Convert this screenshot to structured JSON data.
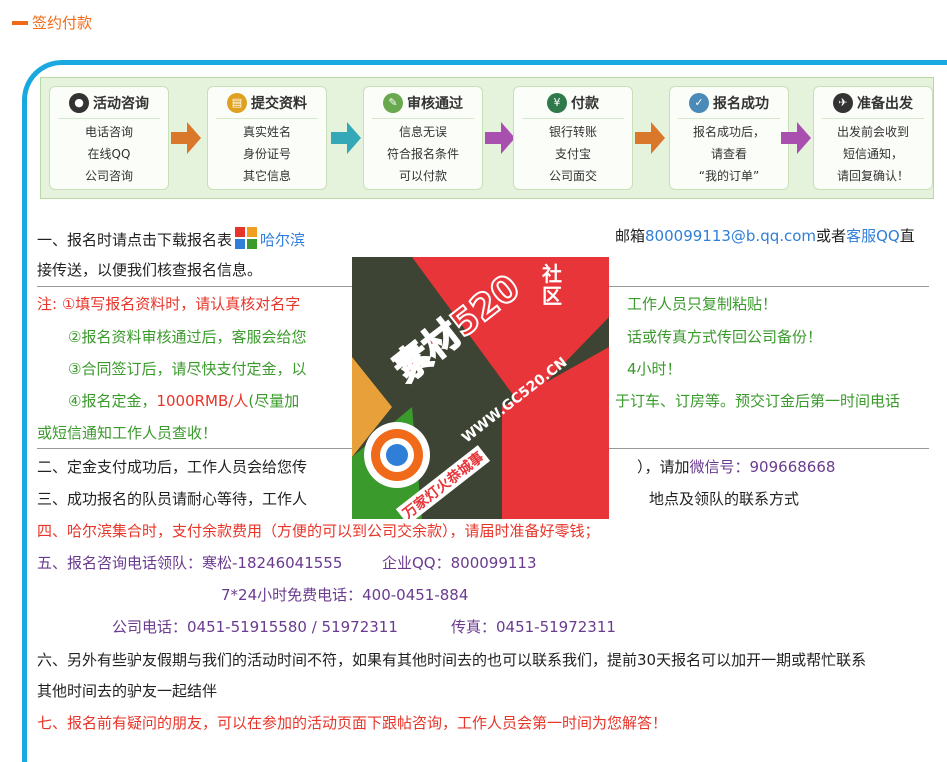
{
  "section": {
    "title": "签约付款"
  },
  "flow": {
    "steps": [
      {
        "icon": "user-icon",
        "title": "活动咨询",
        "lines": [
          "电话咨询",
          "在线QQ",
          "公司咨询"
        ]
      },
      {
        "icon": "document-icon",
        "title": "提交资料",
        "lines": [
          "真实姓名",
          "身份证号",
          "其它信息"
        ]
      },
      {
        "icon": "edit-icon",
        "title": "审核通过",
        "lines": [
          "信息无误",
          "符合报名条件",
          "可以付款"
        ]
      },
      {
        "icon": "money-icon",
        "title": "付款",
        "lines": [
          "银行转账",
          "支付宝",
          "公司面交"
        ]
      },
      {
        "icon": "check-icon",
        "title": "报名成功",
        "lines": [
          "报名成功后，",
          "请查看",
          "“我的订单”"
        ]
      },
      {
        "icon": "plane-icon",
        "title": "准备出发",
        "lines": [
          "出发前会收到",
          "短信通知，",
          "请回复确认！"
        ]
      }
    ]
  },
  "content": {
    "l1_a": "一、报名时请点击下载报名表",
    "l1_b": "哈尔滨",
    "l1_c": "邮箱",
    "l1_email": "800099113@b.qq.com",
    "l1_d": "或者",
    "l1_kf": "客服QQ",
    "l1_e": "直",
    "l2": "接传送，以便我们核查报名信息。",
    "n1_a": "注:  ①填写报名资料时，请认真核对名字",
    "n1_b": "工作人员只复制粘贴！",
    "n2_a": "②报名资料审核通过后，客服会给您",
    "n2_b": "话或传真方式传回公司备份！",
    "n3_a": "③合同签订后，请尽快支付定金，以",
    "n3_b": "4小时！",
    "n4_a": "④报名定金，",
    "n4_amount": "1000RMB/人",
    "n4_b": "(尽量加",
    "n4_c": "于订车、订房等。预交订金后第一时间电话",
    "n5": "或短信通知工作人员查收！",
    "s2_a": "二、定金支付成功后，工作人员会给您传",
    "s2_b": "），请加",
    "s2_wx": "微信号：909668668",
    "s3_a": "三、成功报名的队员请耐心等待，工作人",
    "s3_b": "地点及领队的联系方式",
    "s4": "四、哈尔滨集合时，支付余款费用（方便的可以到公司交余款），请届时准备好零钱；",
    "s5_a": "五、报名咨询电话领队：寒松-18246041555",
    "s5_b": "企业QQ：800099113",
    "s5_c": "7*24小时免费电话：400-0451-884",
    "s5_d": "公司电话：0451-51915580 / 51972311",
    "s5_e": "传真：0451-51972311",
    "s6_a": "六、另外有些驴友假期与我们的活动时间不符，如果有其他时间去的也可以联系我们，提前30天报名可以加开一期或帮忙联系",
    "s6_b": "其他时间去的驴友一起结伴",
    "s7": "七、报名前有疑问的朋友，可以在参加的活动页面下跟帖咨询，工作人员会第一时间为您解答！"
  },
  "watermark": {
    "brand": "素材520",
    "side": "社区",
    "url": "WWW.GC520.CN",
    "slogan": "万家灯火恭城事"
  },
  "colors": {
    "orange": "#f06a1a",
    "blue_frame": "#1aa8e0",
    "red": "#e8352a",
    "green": "#3a9a2b",
    "purple": "#6a3b8f",
    "link_blue": "#2f7ed8"
  }
}
